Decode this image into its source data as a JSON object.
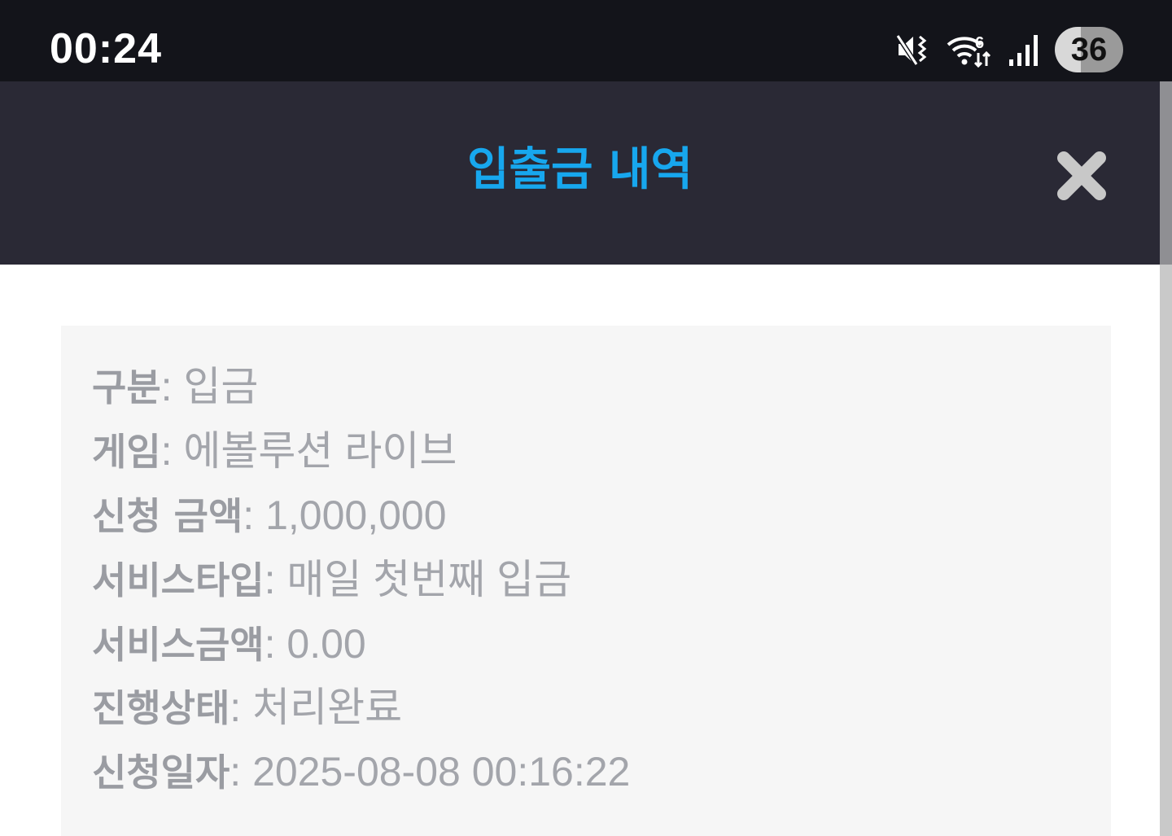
{
  "status_bar": {
    "time": "00:24",
    "battery_level": "36",
    "icons": [
      "mute-vibrate-icon",
      "wifi-icon",
      "signal-icon",
      "battery-icon"
    ]
  },
  "modal": {
    "title": "입출금 내역",
    "close_icon": "close-icon",
    "colors": {
      "header_bg": "#2a2935",
      "title": "#17a7ee",
      "close": "#c8c8c8",
      "card_bg": "#f6f6f6",
      "text": "#9ea0a6"
    }
  },
  "details": [
    {
      "label": "구분",
      "value": ": 입금"
    },
    {
      "label": "게임",
      "value": ": 에볼루션 라이브"
    },
    {
      "label": "신청 금액",
      "value": ": 1,000,000"
    },
    {
      "label": "서비스타입",
      "value": ": 매일 첫번째 입금"
    },
    {
      "label": "서비스금액",
      "value": ": 0.00"
    },
    {
      "label": "진행상태",
      "value": ": 처리완료"
    },
    {
      "label": "신청일자",
      "value": ": 2025-08-08 00:16:22"
    }
  ]
}
